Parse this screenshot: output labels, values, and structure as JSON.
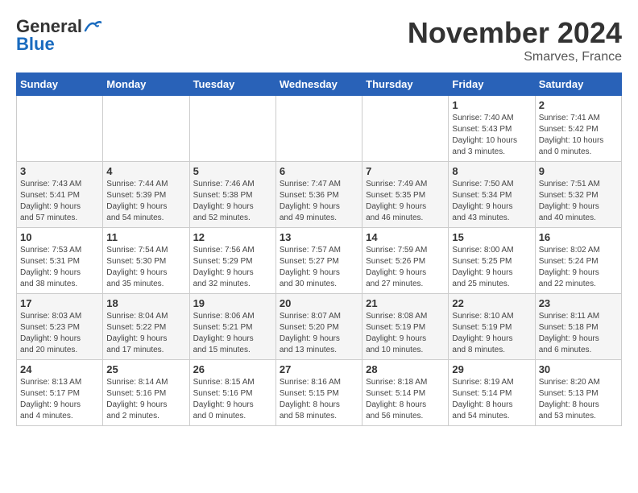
{
  "logo": {
    "line1": "General",
    "line2": "Blue"
  },
  "title": "November 2024",
  "subtitle": "Smarves, France",
  "headers": [
    "Sunday",
    "Monday",
    "Tuesday",
    "Wednesday",
    "Thursday",
    "Friday",
    "Saturday"
  ],
  "weeks": [
    [
      {
        "day": "",
        "info": ""
      },
      {
        "day": "",
        "info": ""
      },
      {
        "day": "",
        "info": ""
      },
      {
        "day": "",
        "info": ""
      },
      {
        "day": "",
        "info": ""
      },
      {
        "day": "1",
        "info": "Sunrise: 7:40 AM\nSunset: 5:43 PM\nDaylight: 10 hours\nand 3 minutes."
      },
      {
        "day": "2",
        "info": "Sunrise: 7:41 AM\nSunset: 5:42 PM\nDaylight: 10 hours\nand 0 minutes."
      }
    ],
    [
      {
        "day": "3",
        "info": "Sunrise: 7:43 AM\nSunset: 5:41 PM\nDaylight: 9 hours\nand 57 minutes."
      },
      {
        "day": "4",
        "info": "Sunrise: 7:44 AM\nSunset: 5:39 PM\nDaylight: 9 hours\nand 54 minutes."
      },
      {
        "day": "5",
        "info": "Sunrise: 7:46 AM\nSunset: 5:38 PM\nDaylight: 9 hours\nand 52 minutes."
      },
      {
        "day": "6",
        "info": "Sunrise: 7:47 AM\nSunset: 5:36 PM\nDaylight: 9 hours\nand 49 minutes."
      },
      {
        "day": "7",
        "info": "Sunrise: 7:49 AM\nSunset: 5:35 PM\nDaylight: 9 hours\nand 46 minutes."
      },
      {
        "day": "8",
        "info": "Sunrise: 7:50 AM\nSunset: 5:34 PM\nDaylight: 9 hours\nand 43 minutes."
      },
      {
        "day": "9",
        "info": "Sunrise: 7:51 AM\nSunset: 5:32 PM\nDaylight: 9 hours\nand 40 minutes."
      }
    ],
    [
      {
        "day": "10",
        "info": "Sunrise: 7:53 AM\nSunset: 5:31 PM\nDaylight: 9 hours\nand 38 minutes."
      },
      {
        "day": "11",
        "info": "Sunrise: 7:54 AM\nSunset: 5:30 PM\nDaylight: 9 hours\nand 35 minutes."
      },
      {
        "day": "12",
        "info": "Sunrise: 7:56 AM\nSunset: 5:29 PM\nDaylight: 9 hours\nand 32 minutes."
      },
      {
        "day": "13",
        "info": "Sunrise: 7:57 AM\nSunset: 5:27 PM\nDaylight: 9 hours\nand 30 minutes."
      },
      {
        "day": "14",
        "info": "Sunrise: 7:59 AM\nSunset: 5:26 PM\nDaylight: 9 hours\nand 27 minutes."
      },
      {
        "day": "15",
        "info": "Sunrise: 8:00 AM\nSunset: 5:25 PM\nDaylight: 9 hours\nand 25 minutes."
      },
      {
        "day": "16",
        "info": "Sunrise: 8:02 AM\nSunset: 5:24 PM\nDaylight: 9 hours\nand 22 minutes."
      }
    ],
    [
      {
        "day": "17",
        "info": "Sunrise: 8:03 AM\nSunset: 5:23 PM\nDaylight: 9 hours\nand 20 minutes."
      },
      {
        "day": "18",
        "info": "Sunrise: 8:04 AM\nSunset: 5:22 PM\nDaylight: 9 hours\nand 17 minutes."
      },
      {
        "day": "19",
        "info": "Sunrise: 8:06 AM\nSunset: 5:21 PM\nDaylight: 9 hours\nand 15 minutes."
      },
      {
        "day": "20",
        "info": "Sunrise: 8:07 AM\nSunset: 5:20 PM\nDaylight: 9 hours\nand 13 minutes."
      },
      {
        "day": "21",
        "info": "Sunrise: 8:08 AM\nSunset: 5:19 PM\nDaylight: 9 hours\nand 10 minutes."
      },
      {
        "day": "22",
        "info": "Sunrise: 8:10 AM\nSunset: 5:19 PM\nDaylight: 9 hours\nand 8 minutes."
      },
      {
        "day": "23",
        "info": "Sunrise: 8:11 AM\nSunset: 5:18 PM\nDaylight: 9 hours\nand 6 minutes."
      }
    ],
    [
      {
        "day": "24",
        "info": "Sunrise: 8:13 AM\nSunset: 5:17 PM\nDaylight: 9 hours\nand 4 minutes."
      },
      {
        "day": "25",
        "info": "Sunrise: 8:14 AM\nSunset: 5:16 PM\nDaylight: 9 hours\nand 2 minutes."
      },
      {
        "day": "26",
        "info": "Sunrise: 8:15 AM\nSunset: 5:16 PM\nDaylight: 9 hours\nand 0 minutes."
      },
      {
        "day": "27",
        "info": "Sunrise: 8:16 AM\nSunset: 5:15 PM\nDaylight: 8 hours\nand 58 minutes."
      },
      {
        "day": "28",
        "info": "Sunrise: 8:18 AM\nSunset: 5:14 PM\nDaylight: 8 hours\nand 56 minutes."
      },
      {
        "day": "29",
        "info": "Sunrise: 8:19 AM\nSunset: 5:14 PM\nDaylight: 8 hours\nand 54 minutes."
      },
      {
        "day": "30",
        "info": "Sunrise: 8:20 AM\nSunset: 5:13 PM\nDaylight: 8 hours\nand 53 minutes."
      }
    ]
  ]
}
